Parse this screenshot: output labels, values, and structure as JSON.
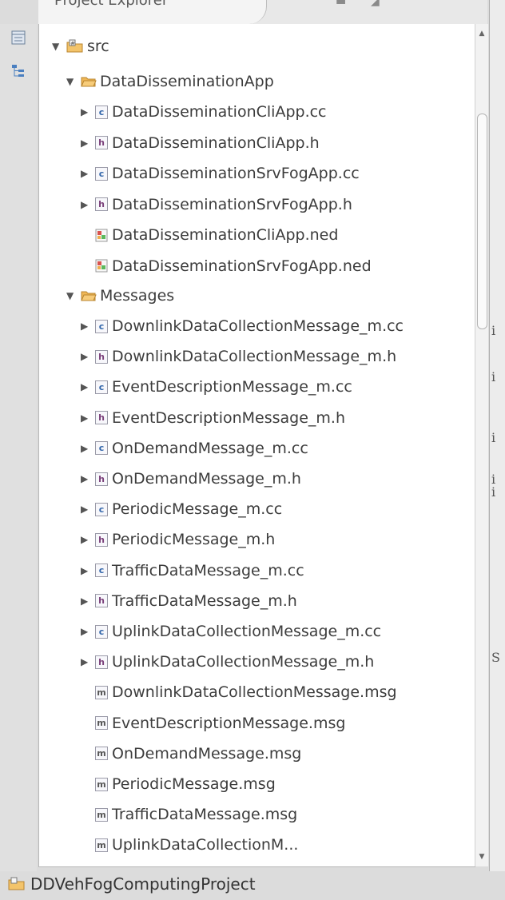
{
  "view_tab": {
    "title": "Project Explorer"
  },
  "tree": {
    "root": {
      "label": "src"
    },
    "folder1": {
      "label": "DataDisseminationApp",
      "files": [
        {
          "name": "DataDisseminationCliApp.cc",
          "type": "cc",
          "expandable": true
        },
        {
          "name": "DataDisseminationCliApp.h",
          "type": "h",
          "expandable": true
        },
        {
          "name": "DataDisseminationSrvFogApp.cc",
          "type": "cc",
          "expandable": true
        },
        {
          "name": "DataDisseminationSrvFogApp.h",
          "type": "h",
          "expandable": true
        },
        {
          "name": "DataDisseminationCliApp.ned",
          "type": "ned",
          "expandable": false
        },
        {
          "name": "DataDisseminationSrvFogApp.ned",
          "type": "ned",
          "expandable": false
        }
      ]
    },
    "folder2": {
      "label": "Messages",
      "files": [
        {
          "name": "DownlinkDataCollectionMessage_m.cc",
          "type": "cc",
          "expandable": true
        },
        {
          "name": "DownlinkDataCollectionMessage_m.h",
          "type": "h",
          "expandable": true
        },
        {
          "name": "EventDescriptionMessage_m.cc",
          "type": "cc",
          "expandable": true
        },
        {
          "name": "EventDescriptionMessage_m.h",
          "type": "h",
          "expandable": true
        },
        {
          "name": "OnDemandMessage_m.cc",
          "type": "cc",
          "expandable": true
        },
        {
          "name": "OnDemandMessage_m.h",
          "type": "h",
          "expandable": true
        },
        {
          "name": "PeriodicMessage_m.cc",
          "type": "cc",
          "expandable": true
        },
        {
          "name": "PeriodicMessage_m.h",
          "type": "h",
          "expandable": true
        },
        {
          "name": "TrafficDataMessage_m.cc",
          "type": "cc",
          "expandable": true
        },
        {
          "name": "TrafficDataMessage_m.h",
          "type": "h",
          "expandable": true
        },
        {
          "name": "UplinkDataCollectionMessage_m.cc",
          "type": "cc",
          "expandable": true
        },
        {
          "name": "UplinkDataCollectionMessage_m.h",
          "type": "h",
          "expandable": true
        },
        {
          "name": "DownlinkDataCollectionMessage.msg",
          "type": "msg",
          "expandable": false
        },
        {
          "name": "EventDescriptionMessage.msg",
          "type": "msg",
          "expandable": false
        },
        {
          "name": "OnDemandMessage.msg",
          "type": "msg",
          "expandable": false
        },
        {
          "name": "PeriodicMessage.msg",
          "type": "msg",
          "expandable": false
        },
        {
          "name": "TrafficDataMessage.msg",
          "type": "msg",
          "expandable": false
        },
        {
          "name": "UplinkDataCollectionM...",
          "type": "msg",
          "expandable": false
        }
      ]
    }
  },
  "right_panel": {
    "fragments": [
      "i",
      "i",
      "i",
      "i",
      "i",
      "S"
    ]
  },
  "status": {
    "project": "DDVehFogComputingProject"
  },
  "icons": {
    "expanded": "triangle-down-icon",
    "collapsed": "triangle-right-icon",
    "folder": "folder-open-icon",
    "source_folder": "source-folder-icon",
    "cc_file": "c-source-file-icon",
    "h_file": "header-file-icon",
    "msg_file": "msg-file-icon",
    "ned_file": "ned-file-icon",
    "project": "project-icon"
  },
  "colors": {
    "folder": "#e8a33c",
    "c_badge": "#3366aa",
    "h_badge": "#7a3f7a",
    "panel_bg": "#ffffff",
    "chrome_bg": "#dcdcdc"
  }
}
